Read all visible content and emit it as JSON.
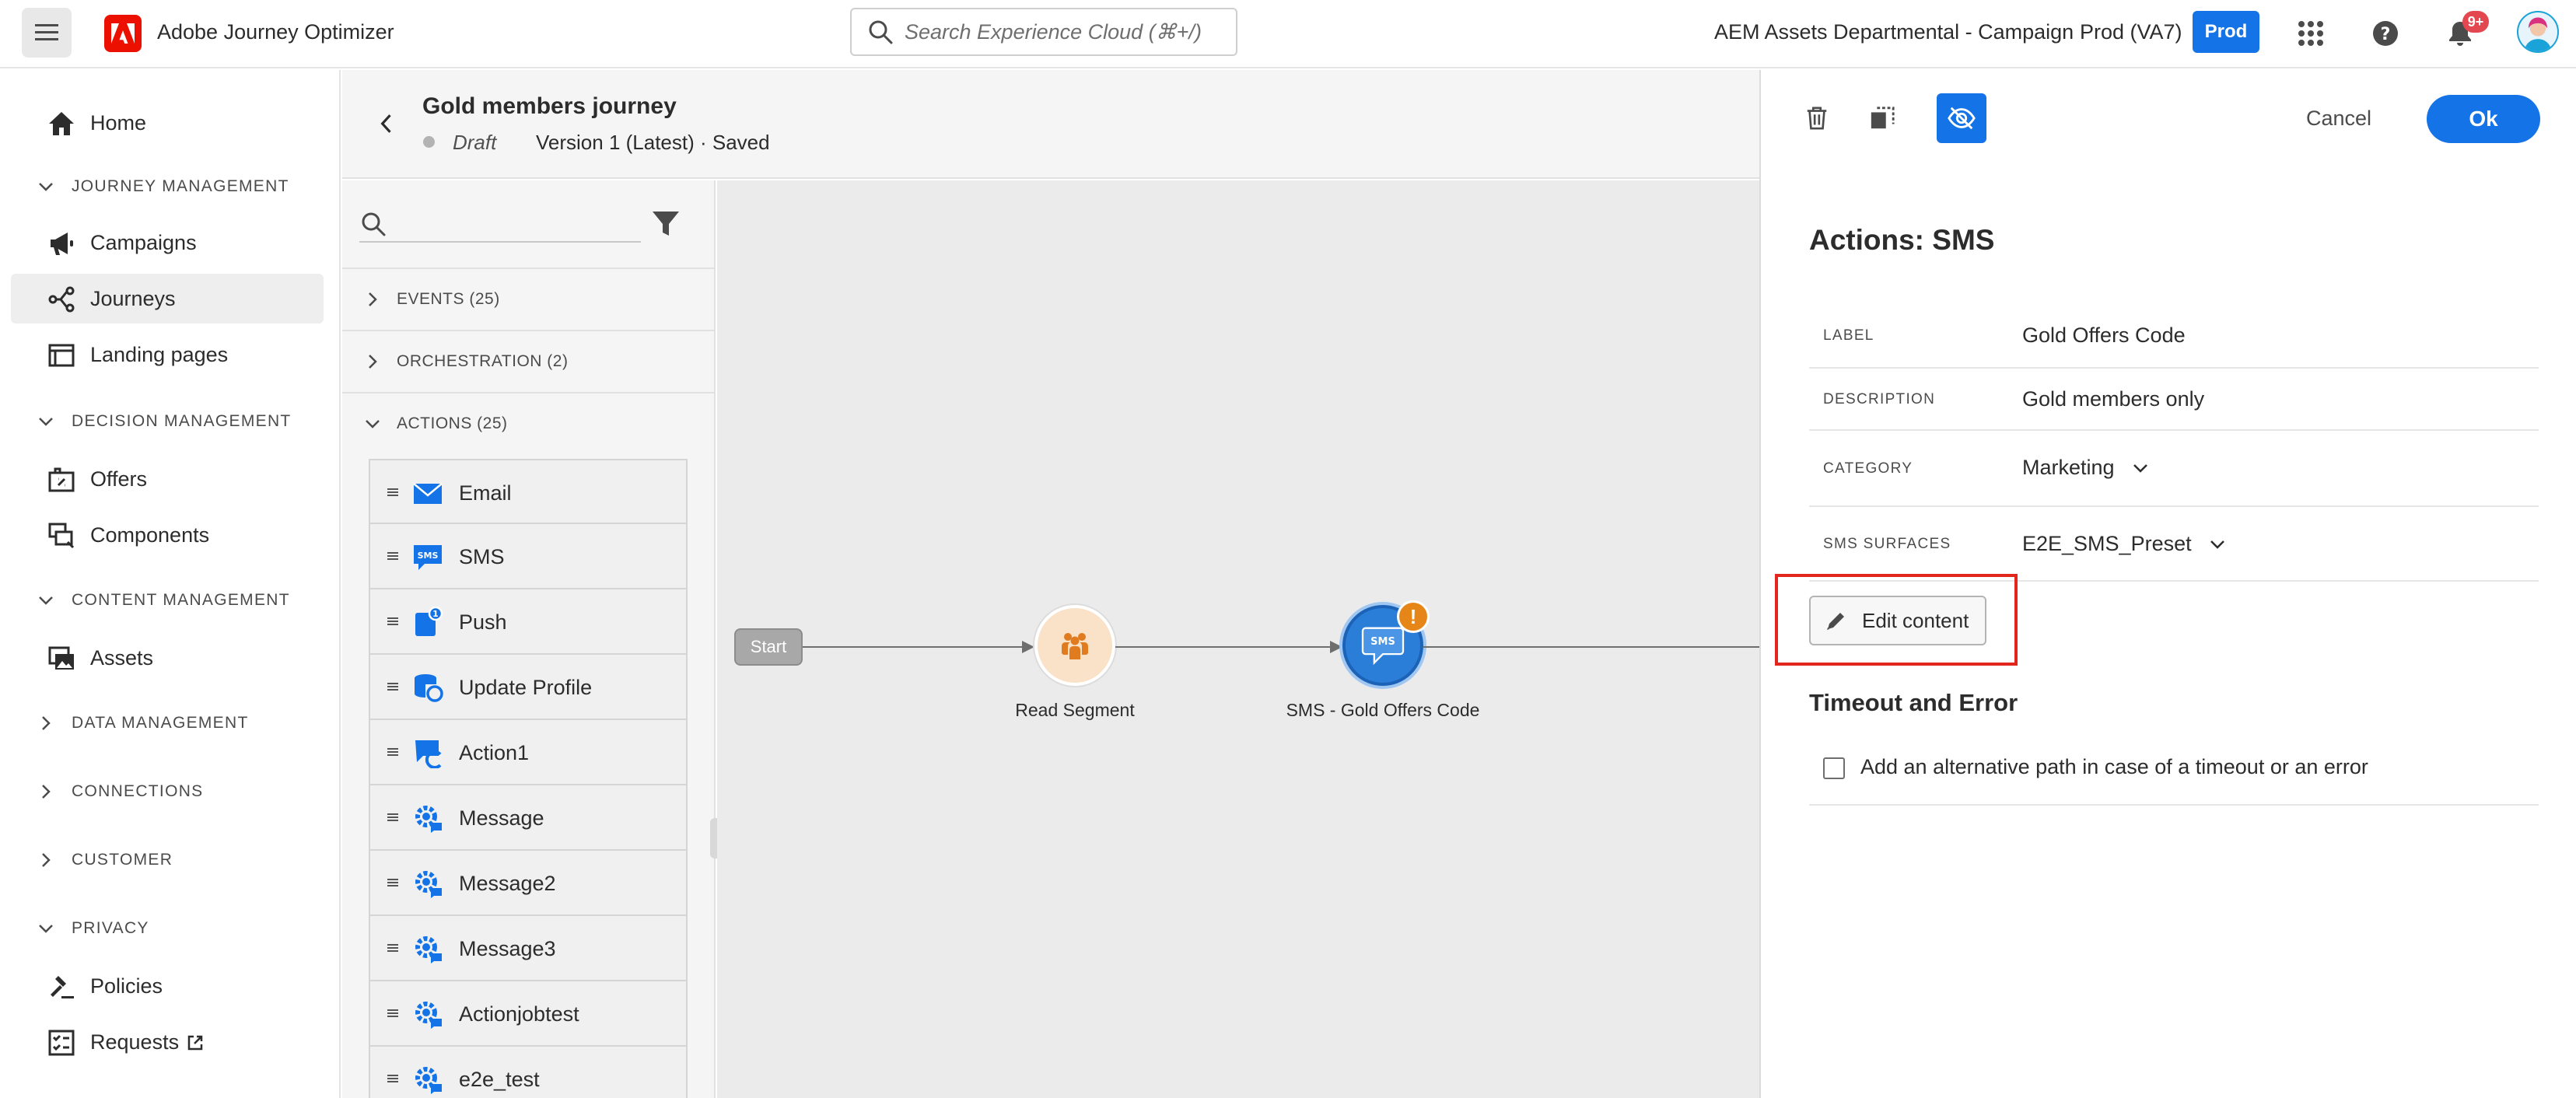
{
  "app": {
    "name": "Adobe Journey Optimizer",
    "search_placeholder": "Search Experience Cloud (⌘+/)",
    "org_name": "AEM Assets Departmental - Campaign",
    "sandbox": "Prod (VA7)",
    "env_badge": "Prod",
    "notification_count": "9+"
  },
  "sidebar": {
    "home": "Home",
    "sections": {
      "journey_management": "JOURNEY MANAGEMENT",
      "decision_management": "DECISION MANAGEMENT",
      "content_management": "CONTENT MANAGEMENT",
      "data_management": "DATA MANAGEMENT",
      "connections": "CONNECTIONS",
      "customer": "CUSTOMER",
      "privacy": "PRIVACY"
    },
    "items": {
      "campaigns": "Campaigns",
      "journeys": "Journeys",
      "landing_pages": "Landing pages",
      "offers": "Offers",
      "components": "Components",
      "assets": "Assets",
      "policies": "Policies",
      "requests": "Requests"
    }
  },
  "journey": {
    "title": "Gold members journey",
    "status": "Draft",
    "version": "Version 1 (Latest) · Saved"
  },
  "palette": {
    "events": "EVENTS (25)",
    "orchestration": "ORCHESTRATION (2)",
    "actions": "ACTIONS (25)",
    "action_items": [
      "Email",
      "SMS",
      "Push",
      "Update Profile",
      "Action1",
      "Message",
      "Message2",
      "Message3",
      "Actionjobtest",
      "e2e_test"
    ]
  },
  "canvas": {
    "start_label": "Start",
    "segment_label": "Read Segment",
    "sms_label": "SMS - Gold Offers Code",
    "sms_node_text": "SMS",
    "warning_symbol": "!"
  },
  "panel": {
    "cancel": "Cancel",
    "ok": "Ok",
    "title": "Actions: SMS",
    "label_key": "LABEL",
    "label_val": "Gold Offers Code",
    "description_key": "DESCRIPTION",
    "description_val": "Gold members only",
    "category_key": "CATEGORY",
    "category_val": "Marketing",
    "surfaces_key": "SMS SURFACES",
    "surfaces_val": "E2E_SMS_Preset",
    "edit_content": "Edit content",
    "timeout_title": "Timeout and Error",
    "timeout_checkbox": "Add an alternative path in case of a timeout or an error"
  },
  "colors": {
    "accent": "#1473e6",
    "adobe_red": "#eb1000",
    "highlight": "#e3261d",
    "warning": "#e68619"
  }
}
